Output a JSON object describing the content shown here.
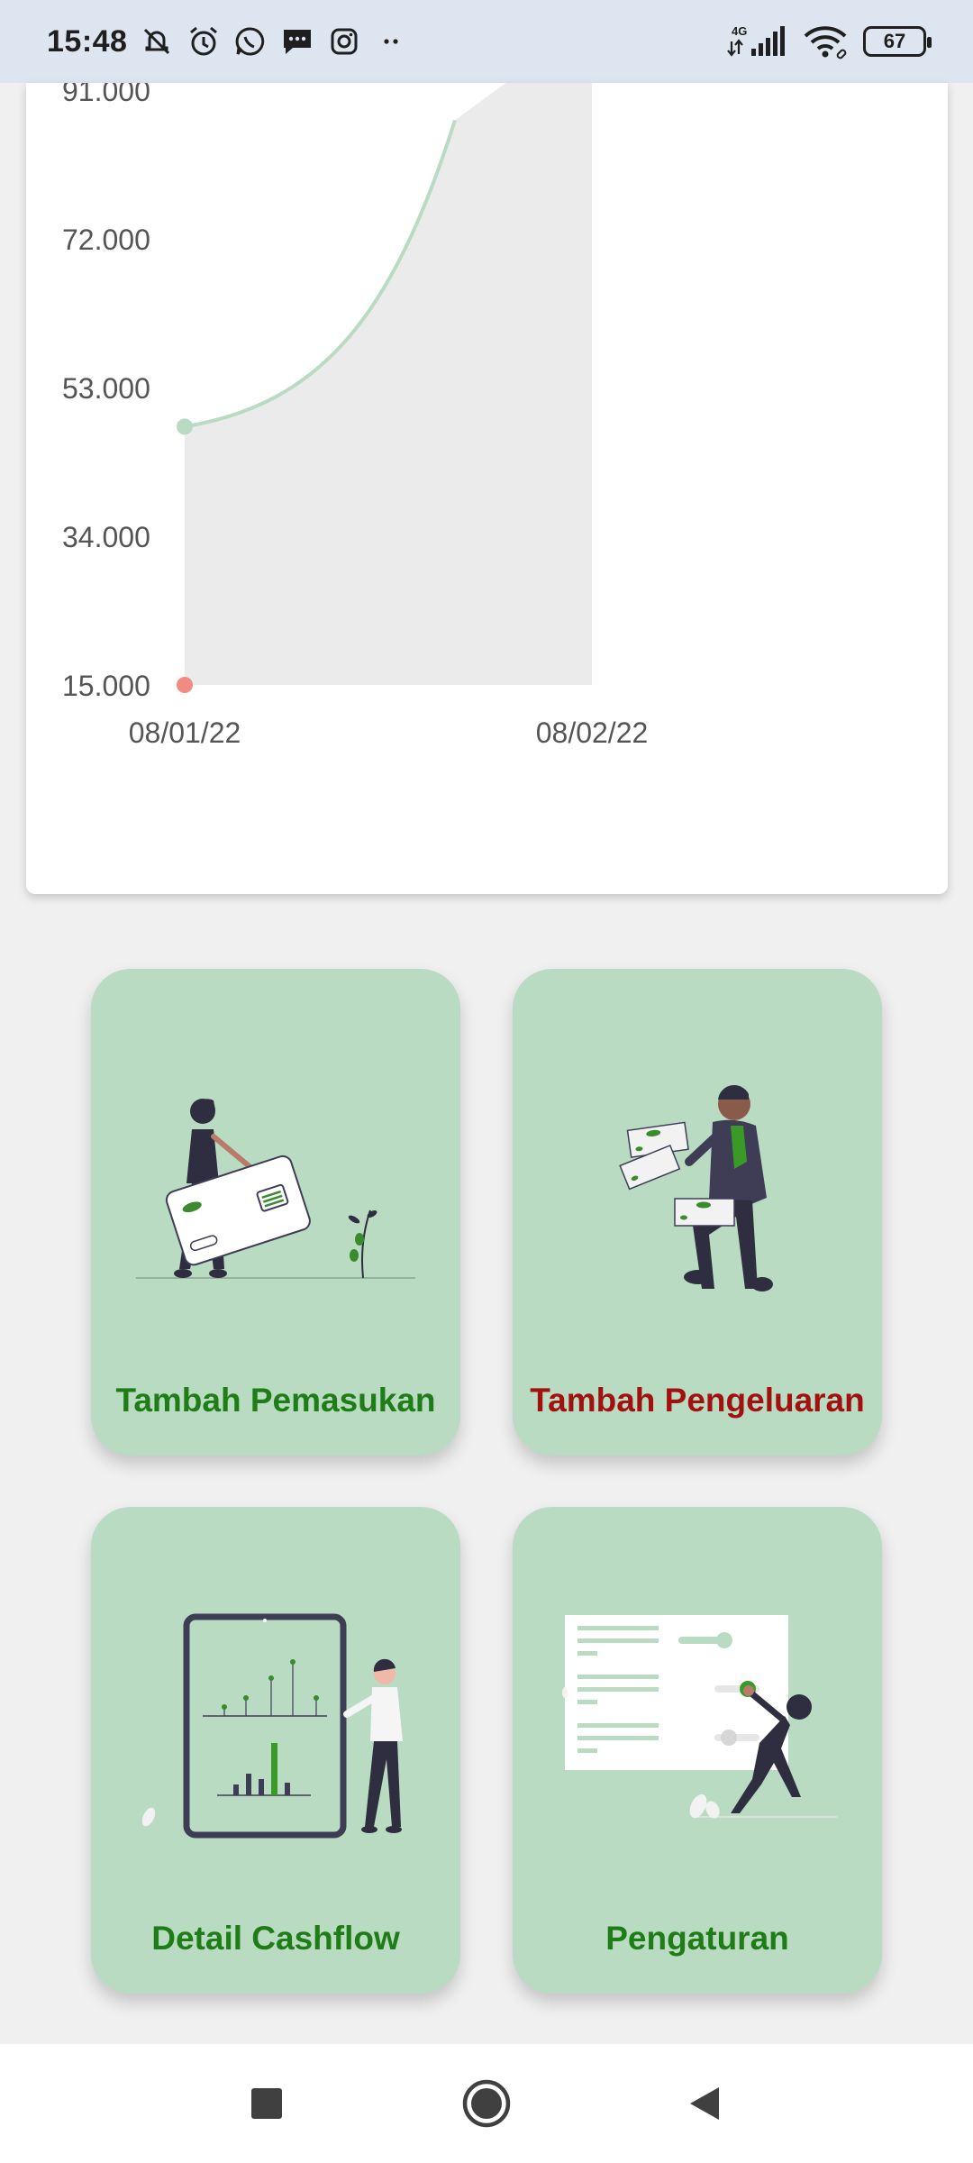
{
  "status_bar": {
    "time": "15:48",
    "network": "4G",
    "battery": "67",
    "icons_left": [
      "mute-icon",
      "alarm-icon",
      "whatsapp-icon",
      "message-icon",
      "instagram-icon",
      "more-dots-icon"
    ],
    "icons_right": [
      "signal-icon",
      "wifi-icon",
      "battery-icon"
    ]
  },
  "chart_data": {
    "type": "area",
    "x": [
      "08/01/22",
      "08/02/22"
    ],
    "series": [
      {
        "values": [
          15000,
          15000
        ],
        "color": "#f28b82"
      },
      {
        "values": [
          48000,
          100000
        ],
        "color": "#b9dbc2"
      }
    ],
    "y_ticks": [
      "15.000",
      "34.000",
      "53.000",
      "72.000",
      "91.000"
    ],
    "ylim": [
      15000,
      91000
    ],
    "grid": false,
    "fill_color": "#ebebeb"
  },
  "tiles": [
    {
      "label": "Tambah Pemasukan",
      "color": "#1e7d16"
    },
    {
      "label": "Tambah Pengeluaran",
      "color": "#a31010"
    },
    {
      "label": "Detail Cashflow",
      "color": "#1e7d16"
    },
    {
      "label": "Pengaturan",
      "color": "#1e7d16"
    }
  ],
  "nav_bar": {
    "icons": [
      "recents-square-icon",
      "home-circle-icon",
      "back-triangle-icon"
    ]
  }
}
